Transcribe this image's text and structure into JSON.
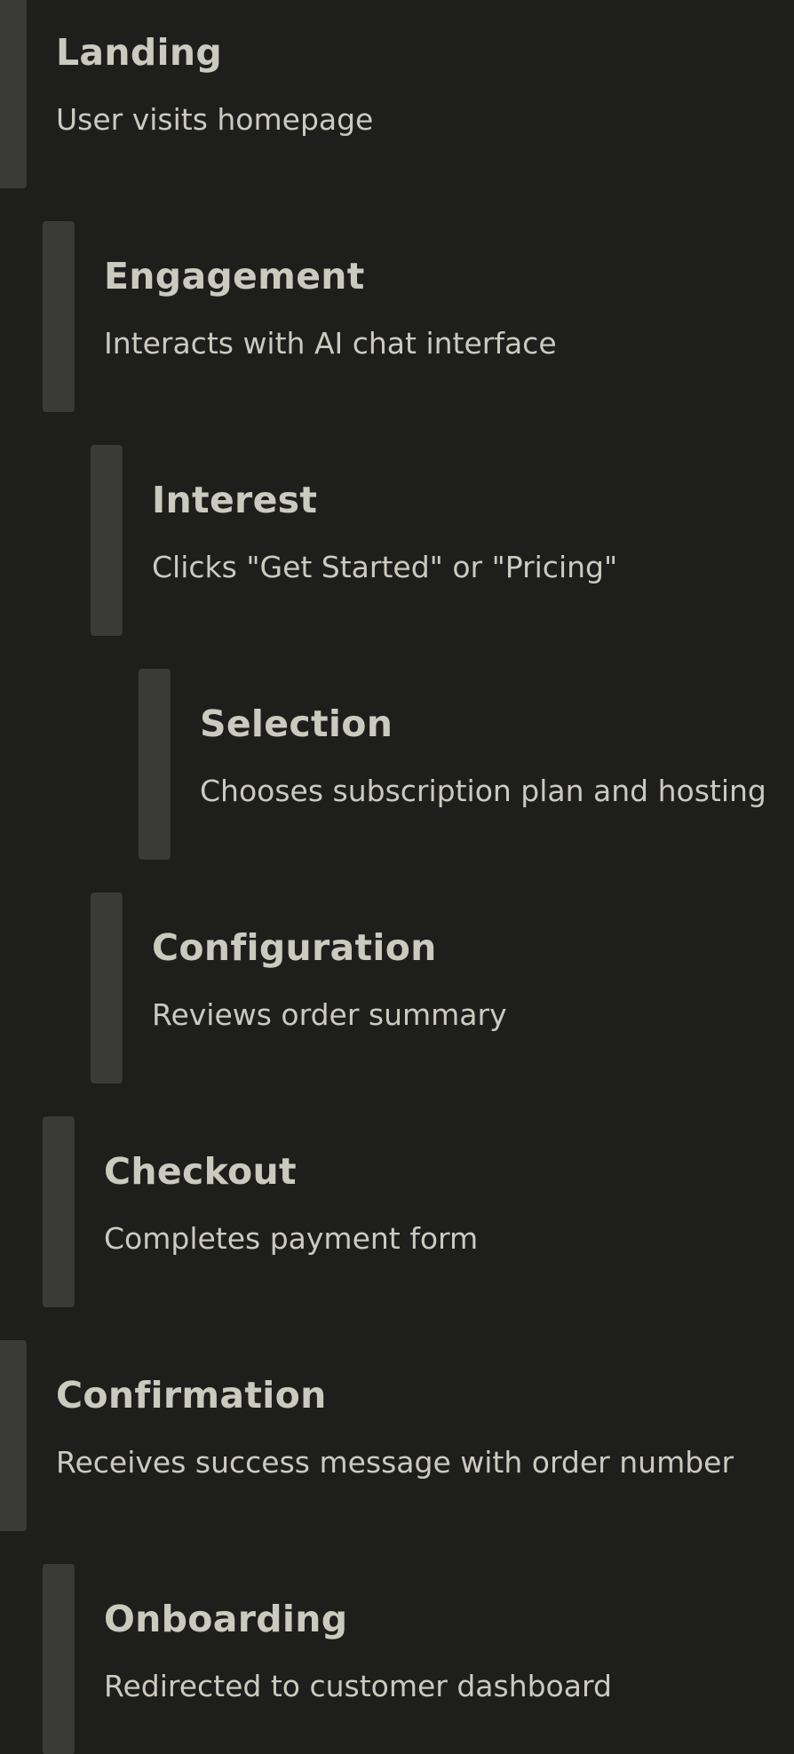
{
  "journey": {
    "steps": [
      {
        "title": "Landing",
        "description": "User visits homepage",
        "indent_level": 0
      },
      {
        "title": "Engagement",
        "description": "Interacts with AI chat interface",
        "indent_level": 1
      },
      {
        "title": "Interest",
        "description": "Clicks \"Get Started\" or \"Pricing\"",
        "indent_level": 2
      },
      {
        "title": "Selection",
        "description": "Chooses subscription plan and hosting",
        "indent_level": 3
      },
      {
        "title": "Configuration",
        "description": "Reviews order summary",
        "indent_level": 2
      },
      {
        "title": "Checkout",
        "description": "Completes payment form",
        "indent_level": 1
      },
      {
        "title": "Confirmation",
        "description": "Receives success message with order number",
        "indent_level": 0
      },
      {
        "title": "Onboarding",
        "description": "Redirected to customer dashboard",
        "indent_level": 1
      }
    ]
  },
  "colors": {
    "background": "#1e1e1d",
    "bar": "#3a3a38",
    "text": "#cbcabf"
  }
}
